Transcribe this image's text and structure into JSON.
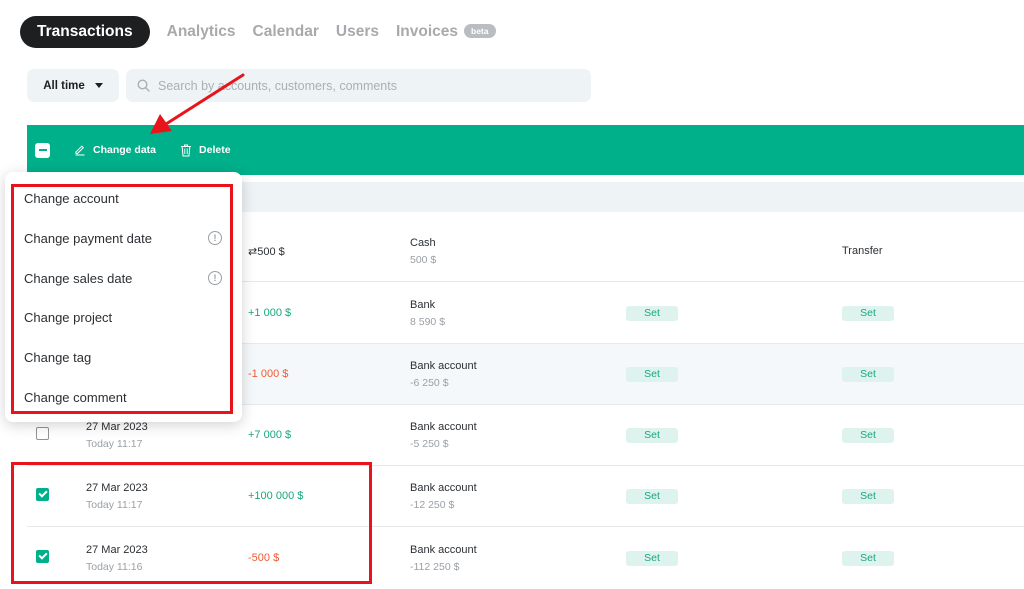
{
  "tabs": [
    {
      "label": "Transactions",
      "active": true
    },
    {
      "label": "Analytics"
    },
    {
      "label": "Calendar"
    },
    {
      "label": "Users"
    },
    {
      "label": "Invoices",
      "badge": "beta"
    }
  ],
  "filter": {
    "period_label": "All time"
  },
  "search": {
    "placeholder": "Search by accounts, customers, comments"
  },
  "actionbar": {
    "change_label": "Change data",
    "delete_label": "Delete"
  },
  "menu": {
    "items": [
      "Change account",
      "Change payment date",
      "Change sales date",
      "Change project",
      "Change tag",
      "Change comment"
    ]
  },
  "rows": [
    {
      "date": "",
      "time": "",
      "amount": "⇄500 $",
      "account": "Cash",
      "balance": "500 $",
      "category": "Transfer",
      "checked": false
    },
    {
      "date": "",
      "time": "",
      "amount": "+1 000 $",
      "account": "Bank",
      "balance": "8 590 $",
      "set_a": "Set",
      "set_b": "Set",
      "checked": false
    },
    {
      "date": "",
      "time": "",
      "amount": "-1 000 $",
      "account": "Bank account",
      "balance": "-6 250 $",
      "set_a": "Set",
      "set_b": "Set",
      "checked": false
    },
    {
      "date": "27 Mar 2023",
      "time": "Today 11:17",
      "amount": "+7 000 $",
      "account": "Bank account",
      "balance": "-5 250 $",
      "set_a": "Set",
      "set_b": "Set",
      "checked": false
    },
    {
      "date": "27 Mar 2023",
      "time": "Today 11:17",
      "amount": "+100 000 $",
      "account": "Bank account",
      "balance": "-12 250 $",
      "set_a": "Set",
      "set_b": "Set",
      "checked": true
    },
    {
      "date": "27 Mar 2023",
      "time": "Today 11:16",
      "amount": "-500 $",
      "account": "Bank account",
      "balance": "-112 250 $",
      "set_a": "Set",
      "set_b": "Set",
      "checked": true
    }
  ],
  "colors": {
    "accent": "#00b08b",
    "positive": "#17a77f",
    "negative": "#f05a33",
    "annotation": "#e8141b"
  }
}
